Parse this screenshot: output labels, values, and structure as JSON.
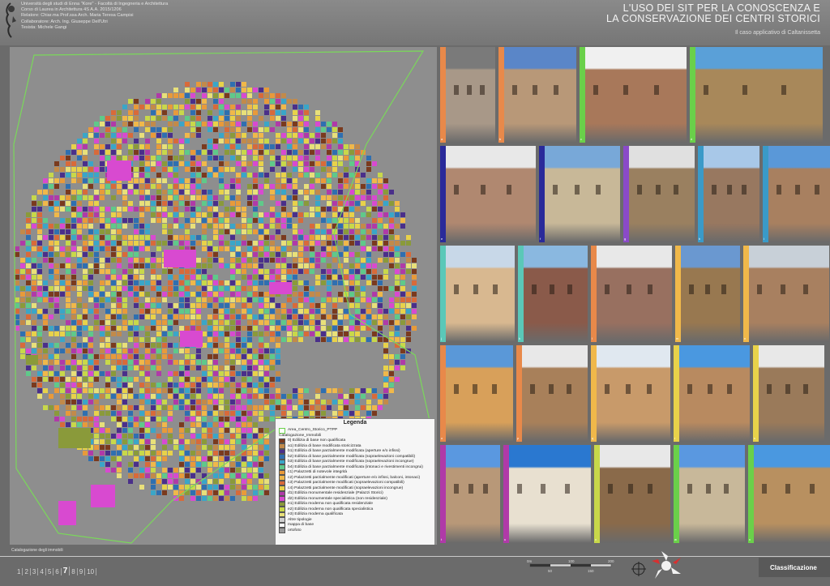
{
  "header": {
    "uni_lines": [
      "Università degli studi di Enna \"Kore\" - Facoltà di Ingegneria e Architettura",
      "Corso di Laurea in Architettura 4S A.A. 2015/1206",
      "Relatore: Chiar.ma Prof.ssa Arch. Maria Teresa Campisi",
      "Collaboratore: Arch. Ing. Giuseppe Dell'Utri",
      "Tesista: Michele Gangi"
    ],
    "title_line1": "L'USO DEI   SIT PER LA CONOSCENZA E",
    "title_line2": "LA CONSERVAZIONE DEI CENTRI STORICI",
    "subtitle": "Il caso applicativo di Caltanissetta"
  },
  "legend": {
    "title": "Legenda",
    "area_label": "Area_Centro_Storico_PTPP",
    "group_label": "Catalogazione_Immobili",
    "items": [
      {
        "label": "0) Edilizia di base non qualificata",
        "color": "#7a3a1e"
      },
      {
        "label": "a1) Edilizia di base modificata storicizzata",
        "color": "#c28a4a"
      },
      {
        "label": "b1) Edilizia di base parzialmente modificata (aperture e/o infissi)",
        "color": "#4a2f8a"
      },
      {
        "label": "b2) Edilizia di base parzialmente modificata (sopraelevazioni compatibili)",
        "color": "#2f6fb0"
      },
      {
        "label": "b3) Edilizia di base parzialmente modificata (sopraelevazioni incongrue)",
        "color": "#3aa6c8"
      },
      {
        "label": "b4) Edilizia di base parzialmente modificata (intonaci e rivestimenti incongrui)",
        "color": "#5fc98a"
      },
      {
        "label": "c1) Palazzetti di notevole integrità",
        "color": "#e89a3a"
      },
      {
        "label": "c2) Palazzetti parzialmente modificati (aperture e/o infissi, balconi, intonaci)",
        "color": "#f0b84a"
      },
      {
        "label": "c3) Palazzetti parzialmente modificati (sopraelevazioni compatibili)",
        "color": "#d86a3a"
      },
      {
        "label": "c4) Palazzetti parzialmente modificati (sopraelevazioni incongrue)",
        "color": "#e8d24a"
      },
      {
        "label": "d1) Edilizia monumentale residenziale (Palazzi Storici)",
        "color": "#b03aa8"
      },
      {
        "label": "d2) Edilizia monumentale specialistica (non residenziale)",
        "color": "#d84ad0"
      },
      {
        "label": "e1) Edilizia moderna non qualificata residenziale",
        "color": "#8a9a3a"
      },
      {
        "label": "e2) Edilizia moderna non qualificata specialistica",
        "color": "#c8d84a"
      },
      {
        "label": "e3) Edilizia moderna qualificata",
        "color": "#e8e07a"
      },
      {
        "label": "Altre tipologie",
        "color": "#d0d0d0"
      },
      {
        "label": "mappa di base",
        "color": "#ffffff"
      },
      {
        "label": "ortofoto",
        "color": "#9a9a9a"
      }
    ]
  },
  "map": {
    "label": "Catalogazione degli immobili"
  },
  "photos": [
    {
      "label": "a",
      "bar": "#e8894a",
      "w": 68,
      "sky": "#7a7a7a",
      "wall": "#a89888"
    },
    {
      "label": "b",
      "bar": "#e8894a",
      "w": 96,
      "sky": "#5a86c8",
      "wall": "#b89878"
    },
    {
      "label": "c",
      "bar": "#6ad04a",
      "w": 132,
      "sky": "#f0f0f0",
      "wall": "#a8785a"
    },
    {
      "label": "d",
      "bar": "#6ad04a",
      "w": 164,
      "sky": "#5aa0d8",
      "wall": "#a8885a"
    },
    {
      "label": "e",
      "bar": "#2a2a9a",
      "w": 118,
      "sky": "#e8e8e8",
      "wall": "#b08870"
    },
    {
      "label": "f",
      "bar": "#2a2a9a",
      "w": 100,
      "sky": "#78a8d8",
      "wall": "#c8b898"
    },
    {
      "label": "g",
      "bar": "#8a4ac8",
      "w": 88,
      "sky": "#e0e0e0",
      "wall": "#9a8060"
    },
    {
      "label": "h",
      "bar": "#3a9ac8",
      "w": 76,
      "sky": "#a8c8e8",
      "wall": "#987860"
    },
    {
      "label": "i",
      "bar": "#3a9ac8",
      "w": 90,
      "sky": "#5a98d8",
      "wall": "#a88060"
    },
    {
      "label": "j",
      "bar": "#5ac8b8",
      "w": 92,
      "sky": "#c8d8e8",
      "wall": "#d8b890"
    },
    {
      "label": "k",
      "bar": "#5ac8b8",
      "w": 86,
      "sky": "#8ab8e0",
      "wall": "#8a5a4a"
    },
    {
      "label": "l",
      "bar": "#e8894a",
      "w": 100,
      "sky": "#e8e8e8",
      "wall": "#987060"
    },
    {
      "label": "m",
      "bar": "#f0b84a",
      "w": 80,
      "sky": "#6a98d0",
      "wall": "#987850"
    },
    {
      "label": "n",
      "bar": "#f0b84a",
      "w": 106,
      "sky": "#c8d0d8",
      "wall": "#a88060"
    },
    {
      "label": "o",
      "bar": "#e8894a",
      "w": 90,
      "sky": "#5a98d8",
      "wall": "#d8a05a"
    },
    {
      "label": "p",
      "bar": "#e8894a",
      "w": 88,
      "sky": "#e8e8e8",
      "wall": "#a8805a"
    },
    {
      "label": "q",
      "bar": "#f0b84a",
      "w": 98,
      "sky": "#e0e8f0",
      "wall": "#c89a6a"
    },
    {
      "label": "r",
      "bar": "#e8d24a",
      "w": 94,
      "sky": "#4a98e0",
      "wall": "#b88a60"
    },
    {
      "label": "s",
      "bar": "#e8d24a",
      "w": 88,
      "sky": "#e8e8e8",
      "wall": "#9a7a5a"
    },
    {
      "label": "t",
      "bar": "#b03aa8",
      "w": 74,
      "sky": "#5a98e0",
      "wall": "#b89878"
    },
    {
      "label": "u",
      "bar": "#b03aa8",
      "w": 108,
      "sky": "#2a78d0",
      "wall": "#e8e0d0"
    },
    {
      "label": "v",
      "bar": "#c8d84a",
      "w": 94,
      "sky": "#e8e8e8",
      "wall": "#8a6a4a"
    },
    {
      "label": "w",
      "bar": "#6ad04a",
      "w": 88,
      "sky": "#5a98e0",
      "wall": "#c8b89a"
    },
    {
      "label": "x",
      "bar": "#6ad04a",
      "w": 108,
      "sky": "#4a98e0",
      "wall": "#b89060"
    }
  ],
  "footer": {
    "pages": [
      "1",
      "2",
      "3",
      "4",
      "5",
      "6",
      "7",
      "8",
      "9",
      "10"
    ],
    "current_page": "7",
    "scale_labels": [
      "0m",
      "100",
      "200",
      "50",
      "150"
    ],
    "classification": "Classificazione"
  }
}
